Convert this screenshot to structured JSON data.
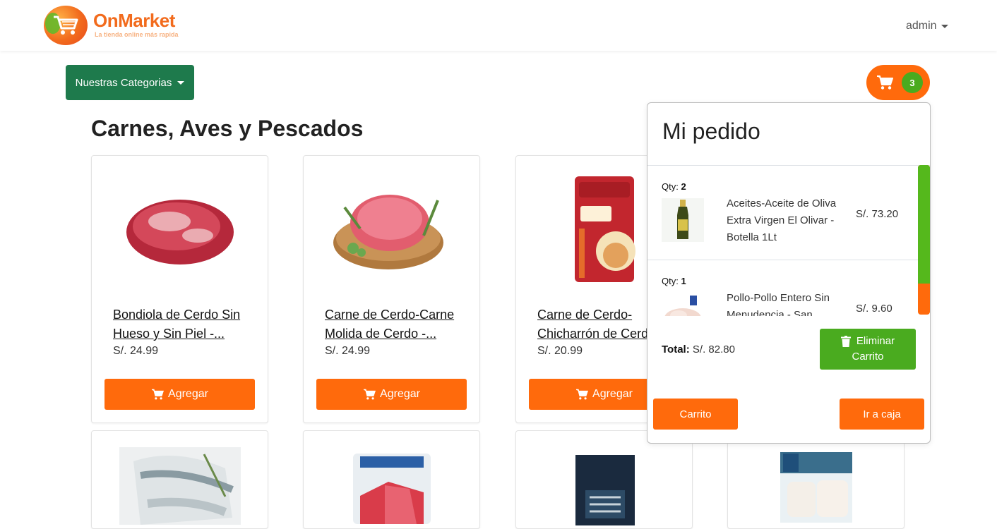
{
  "brand": {
    "name": "OnMarket",
    "tagline": "La tienda online más rapida",
    "colors": {
      "orange": "#ff6a0c",
      "green": "#1e7a4c",
      "lime": "#4aab1f"
    }
  },
  "nav": {
    "user": "admin"
  },
  "categories_button": "Nuestras Categorias",
  "cart": {
    "count": "3",
    "icon": "cart-icon"
  },
  "section": {
    "title": "Carnes, Aves y Pescados"
  },
  "products": [
    {
      "name": "Bondiola de Cerdo Sin Hueso y Sin Piel -...",
      "price": "S/. 24.99",
      "add_label": "Agregar"
    },
    {
      "name": "Carne de Cerdo-Carne Molida de Cerdo -...",
      "price": "S/. 24.99",
      "add_label": "Agregar"
    },
    {
      "name": "Carne de Cerdo-Chicharrón de Cerdo",
      "price": "S/. 20.99",
      "add_label": "Agregar"
    }
  ],
  "order": {
    "title": "Mi pedido",
    "qty_label": "Qty:",
    "items": [
      {
        "qty": "2",
        "name": "Aceites-Aceite de Oliva Extra Virgen El Olivar - Botella 1Lt",
        "price": "S/. 73.20"
      },
      {
        "qty": "1",
        "name": "Pollo-Pollo Entero Sin Menudencia - San",
        "price": "S/. 9.60"
      }
    ],
    "total_label": "Total:",
    "total_value": "S/. 82.80",
    "clear_line1": "Eliminar",
    "clear_line2": "Carrito",
    "cart_button": "Carrito",
    "checkout_button": "Ir a caja"
  }
}
